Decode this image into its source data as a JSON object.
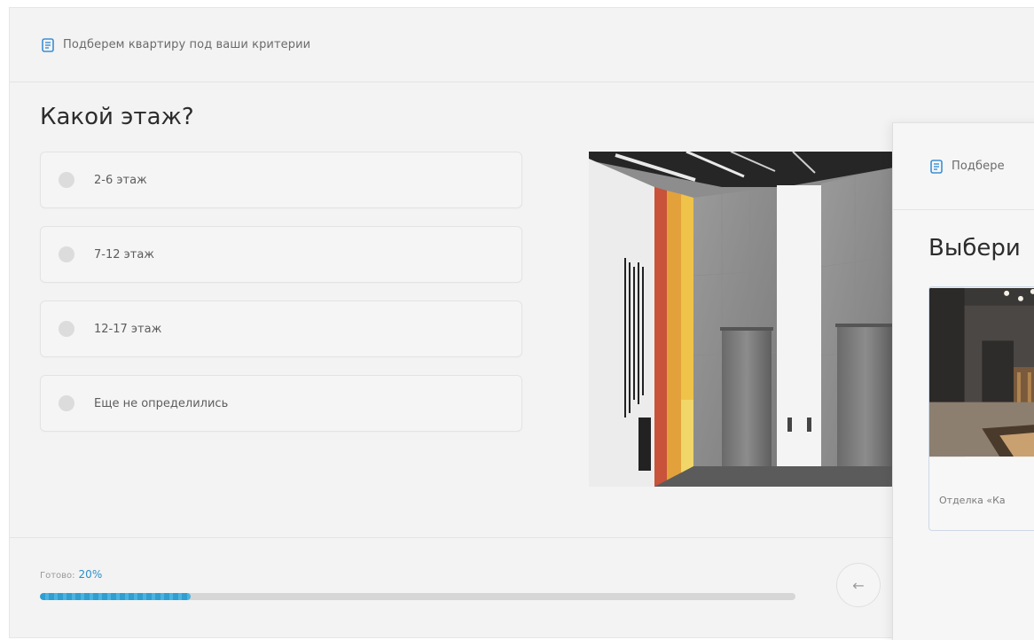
{
  "header": {
    "text": "Подберем квартиру под ваши критерии"
  },
  "question": {
    "title": "Какой этаж?"
  },
  "options": [
    {
      "label": "2-6 этаж"
    },
    {
      "label": "7-12 этаж"
    },
    {
      "label": "12-17 этаж"
    },
    {
      "label": "Еще не определились"
    }
  ],
  "progress": {
    "label": "Готово:",
    "percent_text": "20%",
    "value": 0.2
  },
  "back_button": {
    "icon": "arrow-left-icon",
    "glyph": "←"
  },
  "next_step": {
    "header_text": "Подбере",
    "question": "Выбери",
    "card_caption": "Отделка «Ка"
  },
  "colors": {
    "accent": "#2f9ed0",
    "background": "#f3f3f3"
  }
}
